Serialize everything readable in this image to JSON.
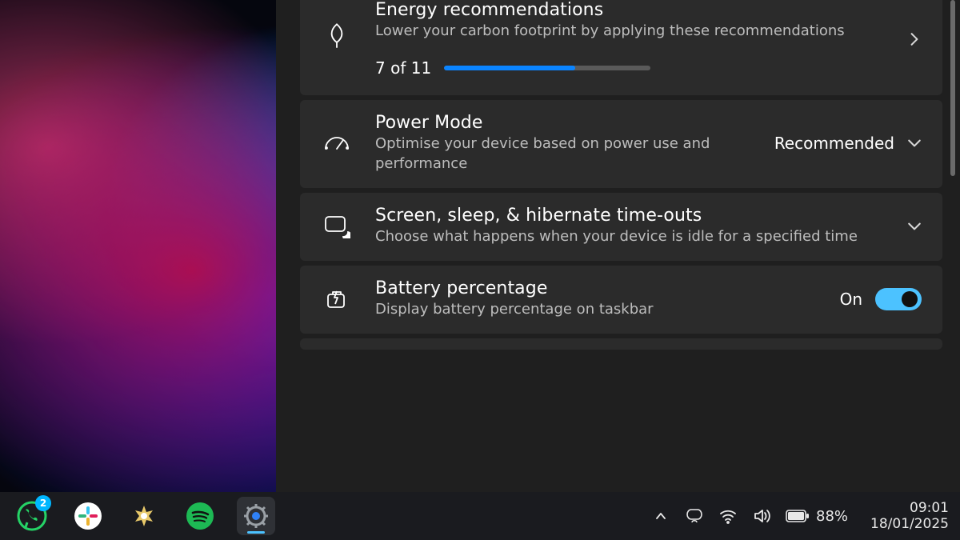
{
  "settings": {
    "energy": {
      "title": "Energy recommendations",
      "subtitle": "Lower your carbon footprint by applying these recommendations",
      "progress_label": "7 of 11",
      "progress_value": 7,
      "progress_max": 11
    },
    "power_mode": {
      "title": "Power Mode",
      "subtitle": "Optimise your device based on power use and performance",
      "value": "Recommended"
    },
    "timeouts": {
      "title": "Screen, sleep, & hibernate time-outs",
      "subtitle": "Choose what happens when your device is idle for a specified time"
    },
    "battery_percentage": {
      "title": "Battery percentage",
      "subtitle": "Display battery percentage on taskbar",
      "state_label": "On",
      "enabled": true
    }
  },
  "taskbar": {
    "whatsapp_badge": "2",
    "battery_label": "88%",
    "time": "09:01",
    "date": "18/01/2025"
  },
  "colors": {
    "accent": "#4cc2ff",
    "progress": "#0a84ff"
  }
}
